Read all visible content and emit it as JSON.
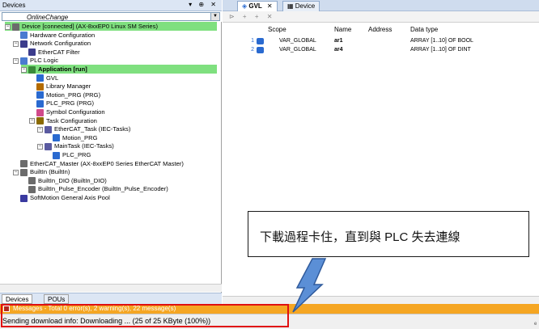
{
  "devices_pane": {
    "title": "Devices",
    "controls": "▾ ⊕ ✕",
    "selector_value": "OnlineChange",
    "tree": [
      {
        "label": "Device [connected] (AX-8xxEP0 Linux SM Series)",
        "level": 1,
        "expander": "−",
        "icon": "device-icon",
        "highlight": "green"
      },
      {
        "label": "Hardware Configuration",
        "level": 2,
        "icon": "hardware-icon"
      },
      {
        "label": "Network Configuration",
        "level": 2,
        "expander": "−",
        "icon": "network-icon"
      },
      {
        "label": "EtherCAT Filter",
        "level": 3,
        "icon": "network-icon"
      },
      {
        "label": "PLC Logic",
        "level": 2,
        "expander": "−",
        "icon": "plc-logic-icon"
      },
      {
        "label": "Application [run]",
        "level": 3,
        "expander": "−",
        "icon": "application-icon",
        "highlight": "green-bold"
      },
      {
        "label": "GVL",
        "level": 4,
        "icon": "gvl-icon"
      },
      {
        "label": "Library Manager",
        "level": 4,
        "icon": "library-icon"
      },
      {
        "label": "Motion_PRG (PRG)",
        "level": 4,
        "icon": "pou-icon"
      },
      {
        "label": "PLC_PRG (PRG)",
        "level": 4,
        "icon": "pou-icon"
      },
      {
        "label": "Symbol Configuration",
        "level": 4,
        "icon": "symbol-icon"
      },
      {
        "label": "Task Configuration",
        "level": 4,
        "expander": "−",
        "icon": "task-config-icon"
      },
      {
        "label": "EtherCAT_Task (IEC-Tasks)",
        "level": 5,
        "expander": "−",
        "icon": "task-icon"
      },
      {
        "label": "Motion_PRG",
        "level": 6,
        "icon": "pou-ref-icon"
      },
      {
        "label": "MainTask (IEC-Tasks)",
        "level": 5,
        "expander": "−",
        "icon": "task-icon"
      },
      {
        "label": "PLC_PRG",
        "level": 6,
        "icon": "pou-ref-icon"
      },
      {
        "label": "EtherCAT_Master (AX-8xxEP0 Series EtherCAT Master)",
        "level": 2,
        "icon": "device-icon"
      },
      {
        "label": "BuiltIn (BuiltIn)",
        "level": 2,
        "expander": "−",
        "icon": "device-icon"
      },
      {
        "label": "BuiltIn_DIO (BuiltIn_DIO)",
        "level": 3,
        "icon": "device-icon"
      },
      {
        "label": "BuiltIn_Pulse_Encoder (BuiltIn_Pulse_Encoder)",
        "level": 3,
        "icon": "device-icon"
      },
      {
        "label": "SoftMotion General Axis Pool",
        "level": 2,
        "icon": "axis-pool-icon"
      }
    ],
    "bottom_tabs": [
      "Devices",
      "POUs"
    ]
  },
  "editor": {
    "tabs": [
      {
        "label": "GVL",
        "active": true,
        "close": "✕"
      },
      {
        "label": "Device",
        "active": false
      }
    ],
    "toolbar_icons": "⊳ + + ✕",
    "columns": [
      "Scope",
      "Name",
      "Address",
      "Data type"
    ],
    "rows": [
      {
        "line": "1",
        "scope": "VAR_GLOBAL",
        "name": "ar1",
        "address": "",
        "datatype": "ARRAY [1..10] OF BOOL"
      },
      {
        "line": "2",
        "scope": "VAR_GLOBAL",
        "name": "ar4",
        "address": "",
        "datatype": "ARRAY [1..10] OF DINT"
      }
    ]
  },
  "messages_bar": {
    "text": "Messages - Total 0 error(s), 2 warning(s), 22 message(s)"
  },
  "status_bar": {
    "text": "Sending download info: Downloading ... (25 of 25 KByte (100%))"
  },
  "annotation": {
    "callout_text": "下載過程卡住，直到與 PLC 失去連線",
    "edge_mark": "e"
  },
  "colors": {
    "highlight_green": "#7fe07f",
    "messages_orange": "#f5a623",
    "red_box": "#e01010",
    "bolt_fill": "#5b8fd6"
  }
}
